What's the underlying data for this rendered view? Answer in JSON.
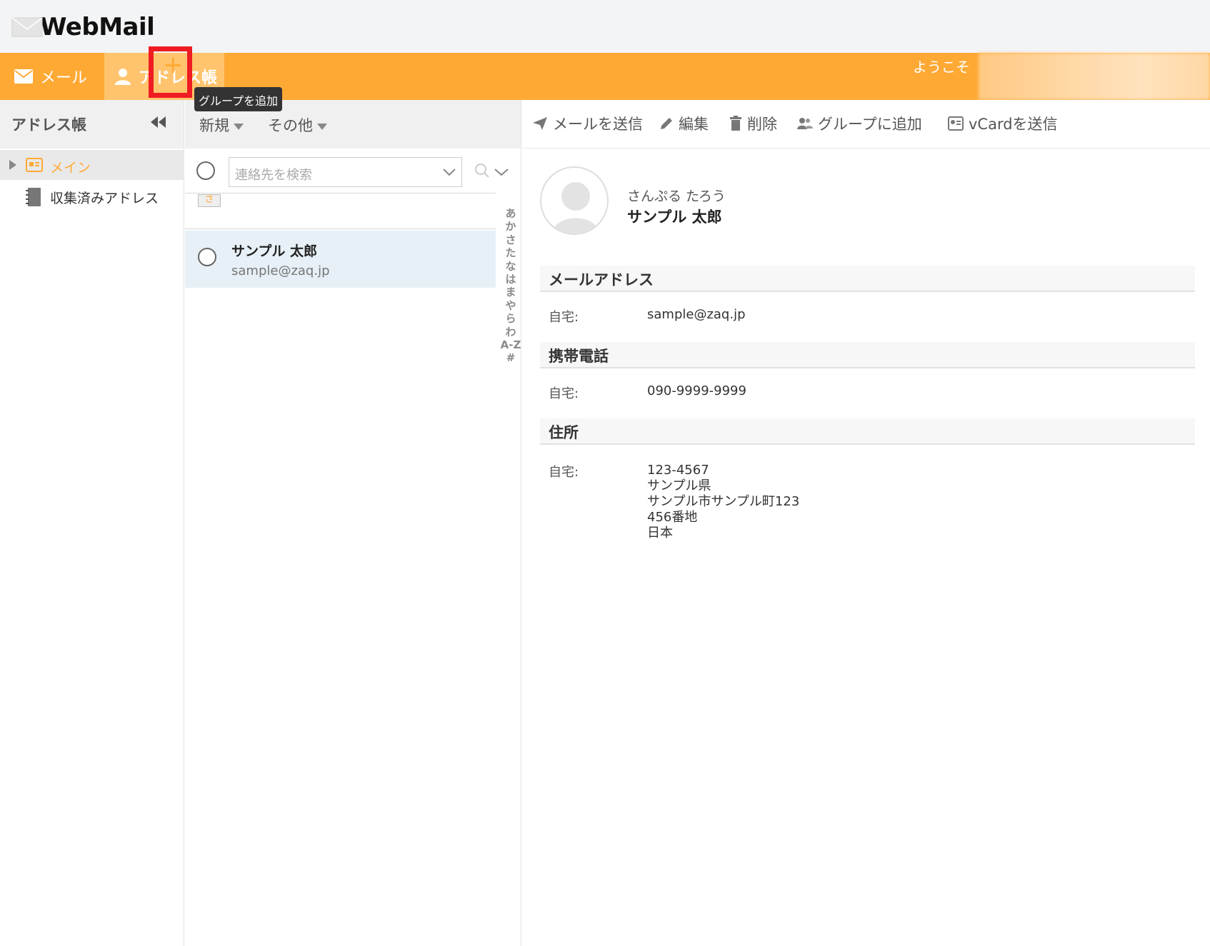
{
  "app": {
    "logo_text": "WebMail"
  },
  "nav": {
    "mail_label": "メール",
    "addressbook_label": "アドレス帳",
    "welcome": "ようこそ"
  },
  "sidebar": {
    "title": "アドレス帳",
    "groups": [
      {
        "label": "メイン"
      },
      {
        "label": "収集済みアドレス"
      }
    ],
    "add_group_tooltip": "グループを追加",
    "add_button_glyph": "+"
  },
  "list": {
    "new_label": "新規",
    "other_label": "その他",
    "search_placeholder": "連絡先を検索",
    "letter_badge": "さ",
    "contacts": [
      {
        "name": "サンプル 太郎",
        "email": "sample@zaq.jp"
      }
    ],
    "alphabet": [
      "あ",
      "か",
      "さ",
      "た",
      "な",
      "は",
      "ま",
      "や",
      "ら",
      "わ",
      "A-Z",
      "#"
    ]
  },
  "toolbar": {
    "send_mail": "メールを送信",
    "edit": "編集",
    "delete": "削除",
    "add_to_group": "グループに追加",
    "send_vcard": "vCardを送信"
  },
  "contact": {
    "kana": "さんぷる たろう",
    "name": "サンプル 太郎",
    "sections": {
      "email": {
        "title": "メールアドレス",
        "label": "自宅:",
        "value": "sample@zaq.jp"
      },
      "mobile": {
        "title": "携帯電話",
        "label": "自宅:",
        "value": "090-9999-9999"
      },
      "address": {
        "title": "住所",
        "label": "自宅:",
        "lines": [
          "123-4567",
          "サンプル県",
          "サンプル市サンプル町123",
          "456番地",
          "日本"
        ]
      }
    }
  },
  "colors": {
    "accent": "#ffa935",
    "highlight": "#ef1c23",
    "selected_row": "#e6f0f6"
  }
}
